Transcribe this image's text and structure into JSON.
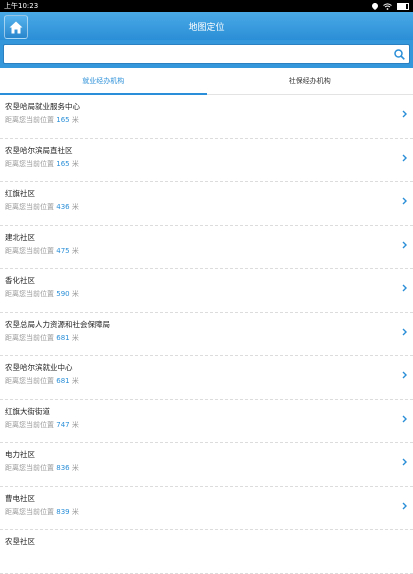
{
  "status": {
    "time": "上午10:23"
  },
  "header": {
    "title": "地图定位"
  },
  "search": {
    "value": "",
    "placeholder": ""
  },
  "tabs": [
    {
      "label": "就业经办机构",
      "active": true
    },
    {
      "label": "社保经办机构",
      "active": false
    }
  ],
  "distance_prefix": "距离您当前位置",
  "distance_unit": "米",
  "items": [
    {
      "name": "农垦哈局就业服务中心",
      "distance": "165"
    },
    {
      "name": "农垦哈尔滨局直社区",
      "distance": "165"
    },
    {
      "name": "红旗社区",
      "distance": "436"
    },
    {
      "name": "建北社区",
      "distance": "475"
    },
    {
      "name": "香化社区",
      "distance": "590"
    },
    {
      "name": "农垦总局人力资源和社会保障局",
      "distance": "681"
    },
    {
      "name": "农垦哈尔滨就业中心",
      "distance": "681"
    },
    {
      "name": "红旗大街街道",
      "distance": "747"
    },
    {
      "name": "电力社区",
      "distance": "836"
    },
    {
      "name": "曹电社区",
      "distance": "839"
    },
    {
      "name": "农垦社区",
      "distance": ""
    }
  ],
  "colors": {
    "accent": "#2a8fd8",
    "header": "#3497dc"
  },
  "icons": {
    "home": "home-icon",
    "search": "search-icon",
    "chevron": "chevron-right-icon"
  }
}
